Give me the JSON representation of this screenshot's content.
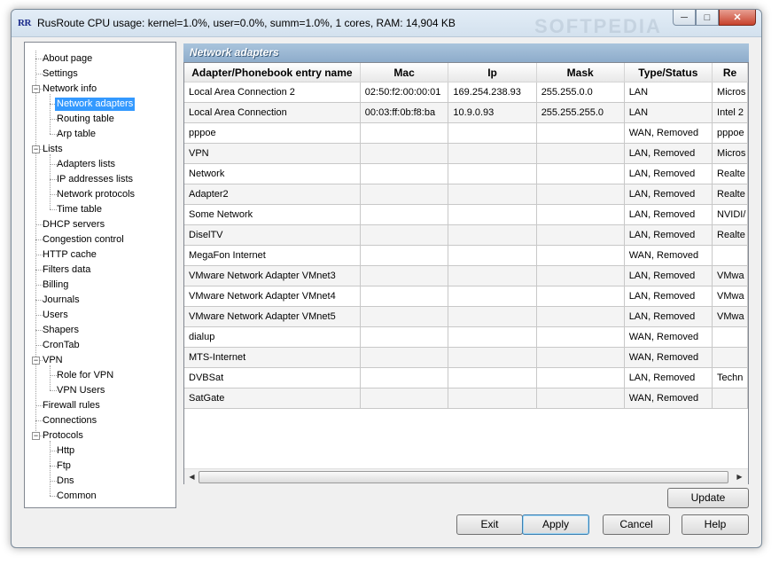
{
  "window": {
    "icon_text": "RR",
    "title": "RusRoute   CPU usage: kernel=1.0%, user=0.0%, summ=1.0%, 1 cores,  RAM: 14,904 KB",
    "watermark": "SOFTPEDIA",
    "controls": {
      "minimize": "─",
      "maximize": "□",
      "close": "✕"
    }
  },
  "tree": {
    "items": [
      {
        "label": "About page"
      },
      {
        "label": "Settings"
      },
      {
        "label": "Network info",
        "expanded": true
      },
      {
        "label": "Network adapters",
        "selected": true
      },
      {
        "label": "Routing table"
      },
      {
        "label": "Arp table"
      },
      {
        "label": "Lists",
        "expanded": true
      },
      {
        "label": "Adapters lists"
      },
      {
        "label": "IP addresses lists"
      },
      {
        "label": "Network protocols"
      },
      {
        "label": "Time table"
      },
      {
        "label": "DHCP servers"
      },
      {
        "label": "Congestion control"
      },
      {
        "label": "HTTP cache"
      },
      {
        "label": "Filters data"
      },
      {
        "label": "Billing"
      },
      {
        "label": "Journals"
      },
      {
        "label": "Users"
      },
      {
        "label": "Shapers"
      },
      {
        "label": "CronTab"
      },
      {
        "label": "VPN",
        "expanded": true
      },
      {
        "label": "Role for VPN"
      },
      {
        "label": "VPN Users"
      },
      {
        "label": "Firewall rules"
      },
      {
        "label": "Connections"
      },
      {
        "label": "Protocols",
        "expanded": true
      },
      {
        "label": "Http"
      },
      {
        "label": "Ftp"
      },
      {
        "label": "Dns"
      },
      {
        "label": "Common"
      }
    ]
  },
  "panel": {
    "title": "Network adapters",
    "columns": [
      "Adapter/Phonebook entry name",
      "Mac",
      "Ip",
      "Mask",
      "Type/Status",
      "Re"
    ],
    "rows": [
      [
        "Local Area Connection 2",
        "02:50:f2:00:00:01",
        "169.254.238.93",
        "255.255.0.0",
        "LAN",
        "Micros"
      ],
      [
        "Local Area Connection",
        "00:03:ff:0b:f8:ba",
        "10.9.0.93",
        "255.255.255.0",
        "LAN",
        "Intel 2"
      ],
      [
        "pppoe",
        "",
        "",
        "",
        "WAN, Removed",
        "pppoe"
      ],
      [
        "VPN",
        "",
        "",
        "",
        "LAN, Removed",
        "Micros"
      ],
      [
        "Network",
        "",
        "",
        "",
        "LAN, Removed",
        "Realte"
      ],
      [
        "Adapter2",
        "",
        "",
        "",
        "LAN, Removed",
        "Realte"
      ],
      [
        "Some Network",
        "",
        "",
        "",
        "LAN, Removed",
        "NVIDI/"
      ],
      [
        "DiselTV",
        "",
        "",
        "",
        "LAN, Removed",
        "Realte"
      ],
      [
        "MegaFon Internet",
        "",
        "",
        "",
        "WAN, Removed",
        ""
      ],
      [
        "VMware Network Adapter VMnet3",
        "",
        "",
        "",
        "LAN, Removed",
        "VMwa"
      ],
      [
        "VMware Network Adapter VMnet4",
        "",
        "",
        "",
        "LAN, Removed",
        "VMwa"
      ],
      [
        "VMware Network Adapter VMnet5",
        "",
        "",
        "",
        "LAN, Removed",
        "VMwa"
      ],
      [
        "dialup",
        "",
        "",
        "",
        "WAN, Removed",
        ""
      ],
      [
        "MTS-Internet",
        "",
        "",
        "",
        "WAN, Removed",
        ""
      ],
      [
        "DVBSat",
        "",
        "",
        "",
        "LAN, Removed",
        "Techn"
      ],
      [
        "SatGate",
        "",
        "",
        "",
        "WAN, Removed",
        ""
      ]
    ]
  },
  "scroll": {
    "left_arrow": "◀",
    "right_arrow": "▶"
  },
  "buttons": {
    "update": "Update",
    "exit": "Exit",
    "apply": "Apply",
    "cancel": "Cancel",
    "help": "Help"
  }
}
